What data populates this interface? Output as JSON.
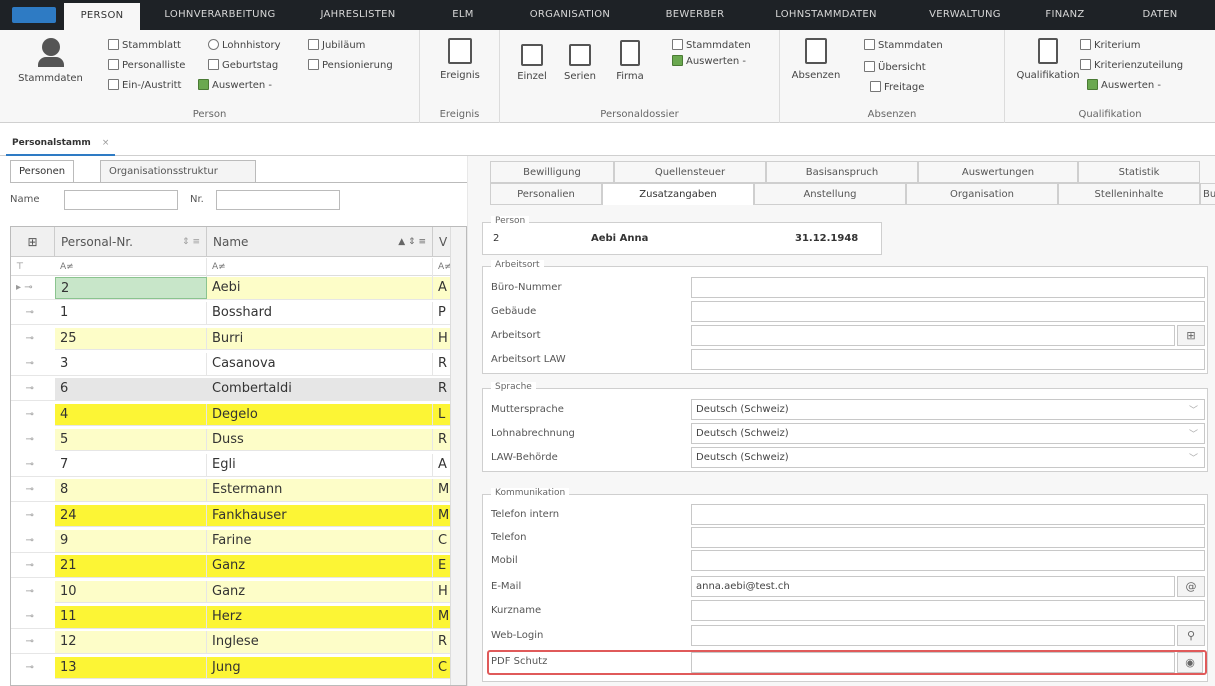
{
  "ribbon_tabs": [
    {
      "label": "PERSON",
      "active": true
    },
    {
      "label": "LOHNVERARBEITUNG"
    },
    {
      "label": "JAHRESLISTEN"
    },
    {
      "label": "ELM"
    },
    {
      "label": "ORGANISATION"
    },
    {
      "label": "BEWERBER"
    },
    {
      "label": "LOHNSTAMMDATEN"
    },
    {
      "label": "VERWALTUNG"
    },
    {
      "label": "FINANZ"
    },
    {
      "label": "DATEN"
    }
  ],
  "ribbon": {
    "person": {
      "big": "Stammdaten",
      "items": [
        "Stammblatt",
        "Lohnhistory",
        "Jubiläum",
        "Personalliste",
        "Geburtstag",
        "Pensionierung",
        "Ein-/Austritt",
        "Auswerten -"
      ],
      "label": "Person"
    },
    "ereignis": {
      "big": "Ereignis",
      "label": "Ereignis"
    },
    "dossier": {
      "items": [
        "Einzel",
        "Serien",
        "Firma"
      ],
      "stammdaten": "Stammdaten",
      "auswerten": "Auswerten -",
      "label": "Personaldossier"
    },
    "absenzen": {
      "big": "Absenzen",
      "items": [
        "Stammdaten",
        "Übersicht",
        "Freitage"
      ],
      "label": "Absenzen"
    },
    "qualifikation": {
      "big": "Qualifikation",
      "items": [
        "Kriterium",
        "Kriterienzuteilung",
        "Auswerten -"
      ],
      "label": "Qualifikation"
    }
  },
  "doc_tab": {
    "label": "Personalstamm",
    "close": "×"
  },
  "left": {
    "tabs": [
      "Personen",
      "Organisationsstruktur"
    ],
    "filter": {
      "name_label": "Name",
      "nr_label": "Nr."
    },
    "columns": {
      "nr": "Personal-Nr.",
      "name": "Name",
      "v": "V"
    },
    "filter_row": {
      "nr": "A≠",
      "name": "A≠",
      "v": "A≠"
    },
    "rows": [
      {
        "nr": "2",
        "name": "Aebi",
        "v": "A",
        "bg": "#fdfdc8",
        "nrbg": "#c8e6c9"
      },
      {
        "nr": "1",
        "name": "Bosshard",
        "v": "P",
        "bg": "#ffffff"
      },
      {
        "nr": "25",
        "name": "Burri",
        "v": "H",
        "bg": "#fdfdc8"
      },
      {
        "nr": "3",
        "name": "Casanova",
        "v": "R",
        "bg": "#ffffff"
      },
      {
        "nr": "6",
        "name": "Combertaldi",
        "v": "R",
        "bg": "#e6e6e6"
      },
      {
        "nr": "4",
        "name": "Degelo",
        "v": "L",
        "bg": "#fcf535"
      },
      {
        "nr": "5",
        "name": "Duss",
        "v": "R",
        "bg": "#fdfdc8"
      },
      {
        "nr": "7",
        "name": "Egli",
        "v": "A",
        "bg": "#ffffff"
      },
      {
        "nr": "8",
        "name": "Estermann",
        "v": "M",
        "bg": "#fdfdc8"
      },
      {
        "nr": "24",
        "name": "Fankhauser",
        "v": "M",
        "bg": "#fcf535"
      },
      {
        "nr": "9",
        "name": "Farine",
        "v": "C",
        "bg": "#fdfdc8"
      },
      {
        "nr": "21",
        "name": "Ganz",
        "v": "E",
        "bg": "#fcf535"
      },
      {
        "nr": "10",
        "name": "Ganz",
        "v": "H",
        "bg": "#fdfdc8"
      },
      {
        "nr": "11",
        "name": "Herz",
        "v": "M",
        "bg": "#fcf535"
      },
      {
        "nr": "12",
        "name": "Inglese",
        "v": "R",
        "bg": "#fdfdc8"
      },
      {
        "nr": "13",
        "name": "Jung",
        "v": "C",
        "bg": "#fcf535"
      }
    ]
  },
  "right": {
    "tabs_top": [
      "Bewilligung",
      "Quellensteuer",
      "Basisanspruch",
      "Auswertungen",
      "Statistik"
    ],
    "tabs_bottom": [
      "Personalien",
      "Zusatzangaben",
      "Anstellung",
      "Organisation",
      "Stelleninhalte",
      "Bu"
    ],
    "person": {
      "legend": "Person",
      "nr": "2",
      "name": "Aebi Anna",
      "date": "31.12.1948"
    },
    "arbeitsort": {
      "legend": "Arbeitsort",
      "fields": [
        "Büro-Nummer",
        "Gebäude",
        "Arbeitsort",
        "Arbeitsort LAW"
      ]
    },
    "sprache": {
      "legend": "Sprache",
      "fields": [
        {
          "label": "Muttersprache",
          "value": "Deutsch (Schweiz)"
        },
        {
          "label": "Lohnabrechnung",
          "value": "Deutsch (Schweiz)"
        },
        {
          "label": "LAW-Behörde",
          "value": "Deutsch (Schweiz)"
        }
      ]
    },
    "kommunikation": {
      "legend": "Kommunikation",
      "fields": [
        {
          "label": "Telefon intern",
          "value": ""
        },
        {
          "label": "Telefon",
          "value": ""
        },
        {
          "label": "Mobil",
          "value": ""
        },
        {
          "label": "E-Mail",
          "value": "anna.aebi@test.ch"
        },
        {
          "label": "Kurzname",
          "value": ""
        },
        {
          "label": "Web-Login",
          "value": ""
        },
        {
          "label": "PDF Schutz",
          "value": ""
        }
      ]
    },
    "highlight_color": "#e05a5a"
  }
}
